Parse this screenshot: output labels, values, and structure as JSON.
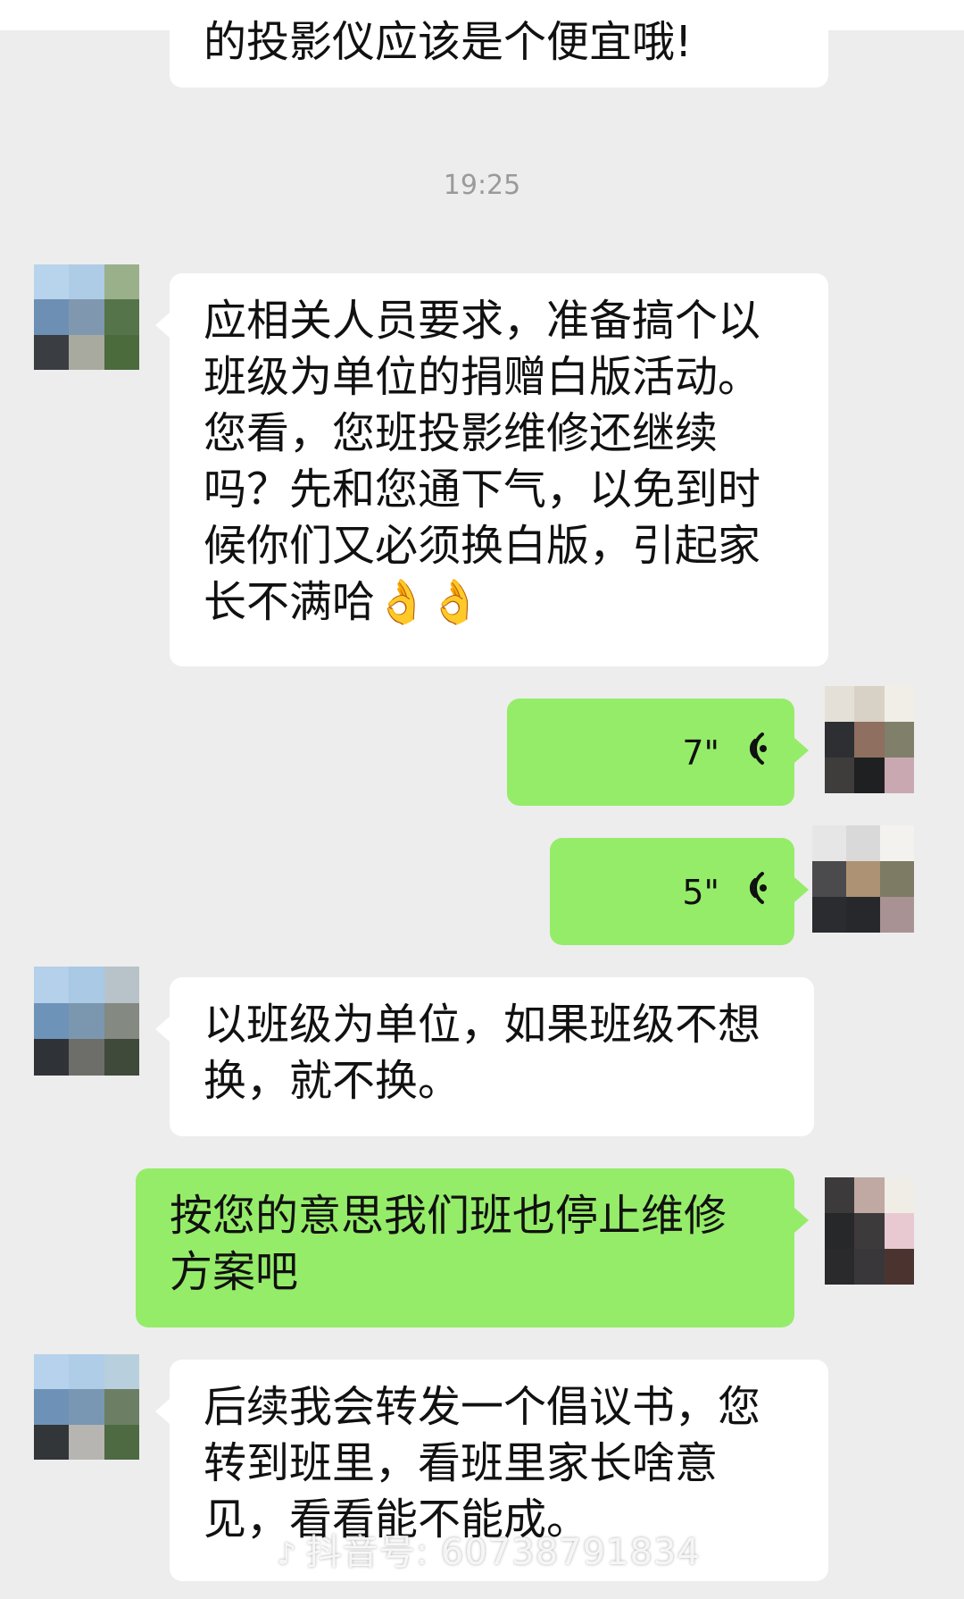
{
  "chat": {
    "prev_message_tail": "的投影仪应该是个便宜哦!",
    "timestamp": "19:25",
    "messages": [
      {
        "id": "m1",
        "side": "in",
        "type": "text",
        "text": "应相关人员要求，准备搞个以班级为单位的捐赠白版活动。您看，您班投影维修还继续吗？先和您通下气，以免到时候你们又必须换白版，引起家长不满哈👌👌"
      },
      {
        "id": "m2",
        "side": "out",
        "type": "voice",
        "duration": "7\""
      },
      {
        "id": "m3",
        "side": "out",
        "type": "voice",
        "duration": "5\""
      },
      {
        "id": "m4",
        "side": "in",
        "type": "text",
        "text": "以班级为单位，如果班级不想换，就不换。"
      },
      {
        "id": "m5",
        "side": "out",
        "type": "text",
        "text": "按您的意思我们班也停止维修方案吧"
      },
      {
        "id": "m6",
        "side": "in",
        "type": "text",
        "text": "后续我会转发一个倡议书，您转到班里，看班里家长啥意见，看看能不能成。"
      }
    ]
  },
  "watermark": {
    "icon": "douyin-logo-icon",
    "text": "抖音号: 60738791834"
  },
  "colors": {
    "background": "#ededed",
    "incoming_bubble": "#ffffff",
    "outgoing_bubble": "#95ec69",
    "timestamp": "#9a9a9a"
  }
}
